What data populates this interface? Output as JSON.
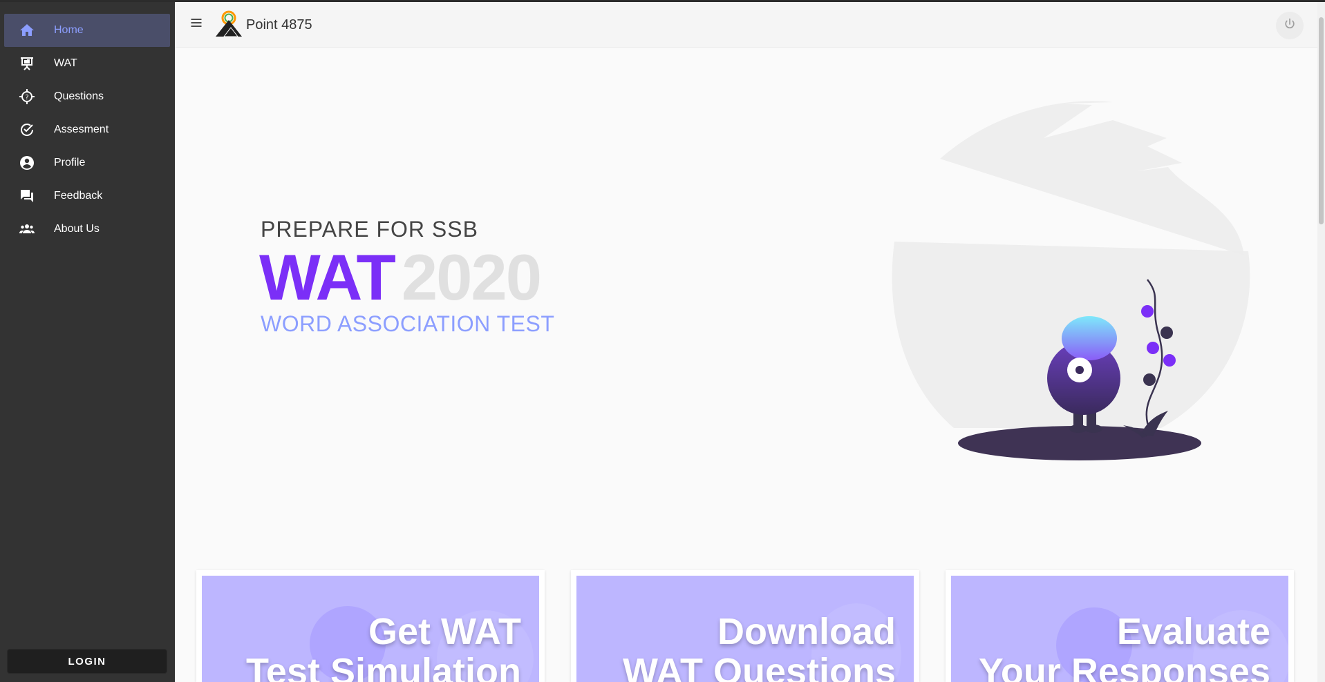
{
  "app": {
    "brand": "Point 4875"
  },
  "sidebar": {
    "items": [
      {
        "label": "Home",
        "icon": "home-icon",
        "active": true
      },
      {
        "label": "WAT",
        "icon": "presentation-icon",
        "active": false
      },
      {
        "label": "Questions",
        "icon": "question-target-icon",
        "active": false
      },
      {
        "label": "Assesment",
        "icon": "check-circle-icon",
        "active": false
      },
      {
        "label": "Profile",
        "icon": "account-circle-icon",
        "active": false
      },
      {
        "label": "Feedback",
        "icon": "forum-icon",
        "active": false
      },
      {
        "label": "About Us",
        "icon": "group-icon",
        "active": false
      }
    ],
    "login_label": "LOGIN"
  },
  "hero": {
    "kicker": "PREPARE FOR SSB",
    "title_main": "WAT",
    "title_year": "2020",
    "subtitle": "WORD ASSOCIATION TEST"
  },
  "cards": [
    {
      "line1": "Get WAT",
      "line2": "Test Simulation"
    },
    {
      "line1": "Download",
      "line2": "WAT Questions"
    },
    {
      "line1": "Evaluate",
      "line2": "Your Responses"
    }
  ],
  "colors": {
    "accent_purple": "#7b2ff7",
    "accent_indigo": "#8c9eff",
    "sidebar_bg": "#333333",
    "card_bg": "#bdb6ff"
  }
}
